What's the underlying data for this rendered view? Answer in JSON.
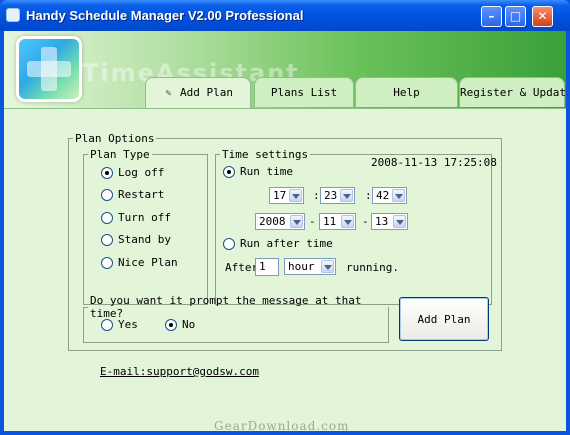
{
  "window": {
    "title": "Handy Schedule Manager V2.00 Professional",
    "controls": {
      "minimize": "–",
      "maximize": "□",
      "close": "✕"
    }
  },
  "banner": {
    "watermark": "TimeAssistant"
  },
  "tabs": [
    {
      "label": "Add Plan",
      "active": true,
      "icon": "pencil-icon"
    },
    {
      "label": "Plans List",
      "active": false
    },
    {
      "label": "Help",
      "active": false
    },
    {
      "label": "Register & Update",
      "active": false
    }
  ],
  "plan_options": {
    "legend": "Plan Options",
    "plan_type": {
      "legend": "Plan Type",
      "options": [
        {
          "label": "Log off",
          "selected": true
        },
        {
          "label": "Restart",
          "selected": false
        },
        {
          "label": "Turn off",
          "selected": false
        },
        {
          "label": "Stand by",
          "selected": false
        },
        {
          "label": "Nice Plan",
          "selected": false
        }
      ]
    },
    "time_settings": {
      "legend": "Time settings",
      "current_datetime": "2008-11-13 17:25:08",
      "run_time_label": "Run time",
      "run_time_selected": true,
      "hour": "17",
      "minute": "23",
      "second": "42",
      "time_sep": ":",
      "year": "2008",
      "month": "11",
      "day": "13",
      "date_sep": "-",
      "run_after_label": "Run after time",
      "run_after_selected": false,
      "after_label": "After",
      "after_value": "1",
      "after_unit": "hour",
      "running_label": "running."
    },
    "prompt": {
      "legend": "Do you want it prompt the message at that time?",
      "yes_label": "Yes",
      "yes_selected": false,
      "no_label": "No",
      "no_selected": true
    },
    "add_plan_button": "Add Plan"
  },
  "email": "E-mail:support@godsw.com",
  "credit": "GearDownload.com",
  "colors": {
    "title_bar": "#0052e0",
    "client_bg": "#e2f5d9",
    "banner_green": "#3aa038"
  }
}
